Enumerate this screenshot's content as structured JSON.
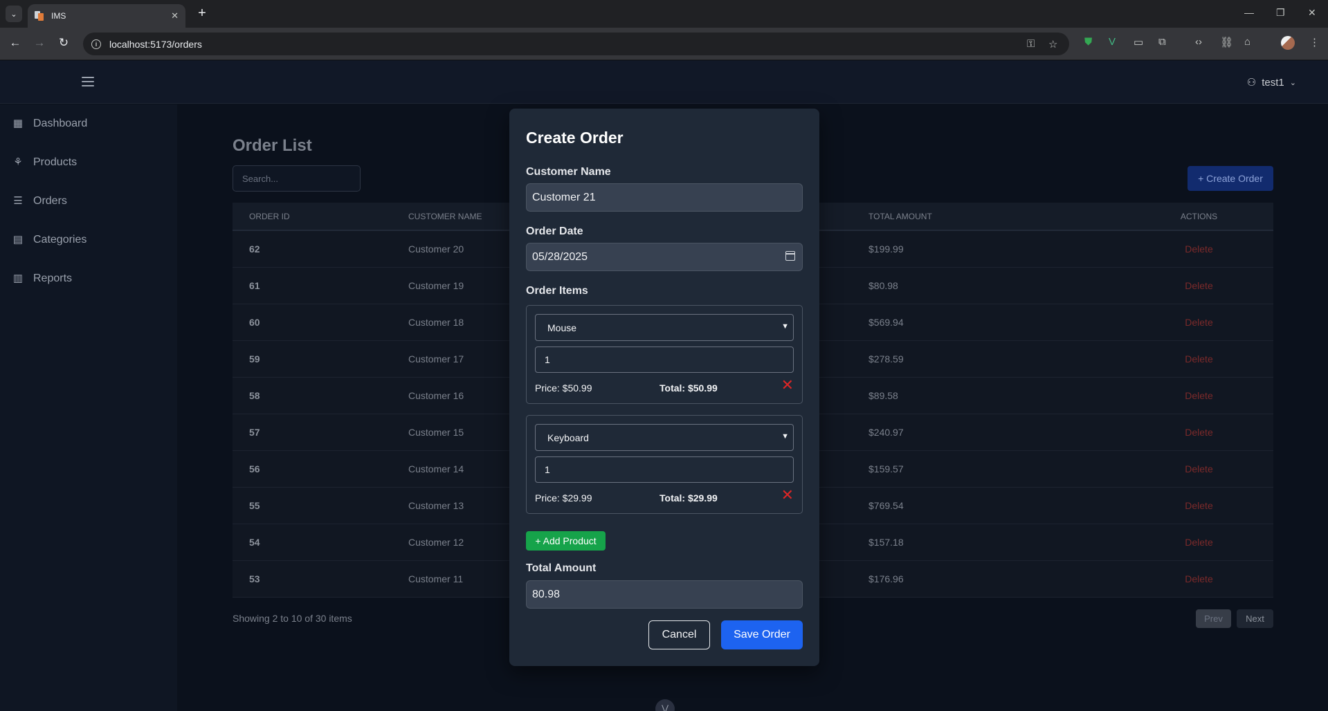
{
  "browser": {
    "tab_title": "IMS",
    "url": "localhost:5173/orders"
  },
  "header": {
    "username": "test1"
  },
  "sidebar": {
    "items": [
      {
        "label": "Dashboard",
        "icon": "grid-icon"
      },
      {
        "label": "Products",
        "icon": "cubes-icon"
      },
      {
        "label": "Orders",
        "icon": "list-icon"
      },
      {
        "label": "Categories",
        "icon": "chart-box-icon"
      },
      {
        "label": "Reports",
        "icon": "bar-chart-icon"
      }
    ]
  },
  "main": {
    "title": "Order List",
    "search_placeholder": "Search...",
    "create_button": "+ Create Order",
    "columns": [
      "ORDER ID",
      "CUSTOMER NAME",
      "TOTAL AMOUNT",
      "ACTIONS"
    ],
    "rows": [
      {
        "id": "62",
        "customer": "Customer 20",
        "total": "$199.99",
        "action": "Delete"
      },
      {
        "id": "61",
        "customer": "Customer 19",
        "total": "$80.98",
        "action": "Delete"
      },
      {
        "id": "60",
        "customer": "Customer 18",
        "total": "$569.94",
        "action": "Delete"
      },
      {
        "id": "59",
        "customer": "Customer 17",
        "total": "$278.59",
        "action": "Delete"
      },
      {
        "id": "58",
        "customer": "Customer 16",
        "total": "$89.58",
        "action": "Delete"
      },
      {
        "id": "57",
        "customer": "Customer 15",
        "total": "$240.97",
        "action": "Delete"
      },
      {
        "id": "56",
        "customer": "Customer 14",
        "total": "$159.57",
        "action": "Delete"
      },
      {
        "id": "55",
        "customer": "Customer 13",
        "total": "$769.54",
        "action": "Delete"
      },
      {
        "id": "54",
        "customer": "Customer 12",
        "total": "$157.18",
        "action": "Delete"
      },
      {
        "id": "53",
        "customer": "Customer 11",
        "total": "$176.96",
        "action": "Delete"
      }
    ],
    "showing": "Showing 2 to 10 of 30 items",
    "prev": "Prev",
    "next": "Next"
  },
  "modal": {
    "title": "Create Order",
    "customer_label": "Customer Name",
    "customer_value": "Customer 21",
    "date_label": "Order Date",
    "date_value": "05/28/2025",
    "items_label": "Order Items",
    "items": [
      {
        "product": "Mouse",
        "qty": "1",
        "price": "Price: $50.99",
        "total": "Total: $50.99"
      },
      {
        "product": "Keyboard",
        "qty": "1",
        "price": "Price: $29.99",
        "total": "Total: $29.99"
      }
    ],
    "add_product": "+ Add Product",
    "total_label": "Total Amount",
    "total_value": "80.98",
    "cancel": "Cancel",
    "save": "Save Order"
  },
  "colors": {
    "accent": "#1d63f0",
    "add_green": "#16a34a",
    "danger": "#dc2626"
  }
}
